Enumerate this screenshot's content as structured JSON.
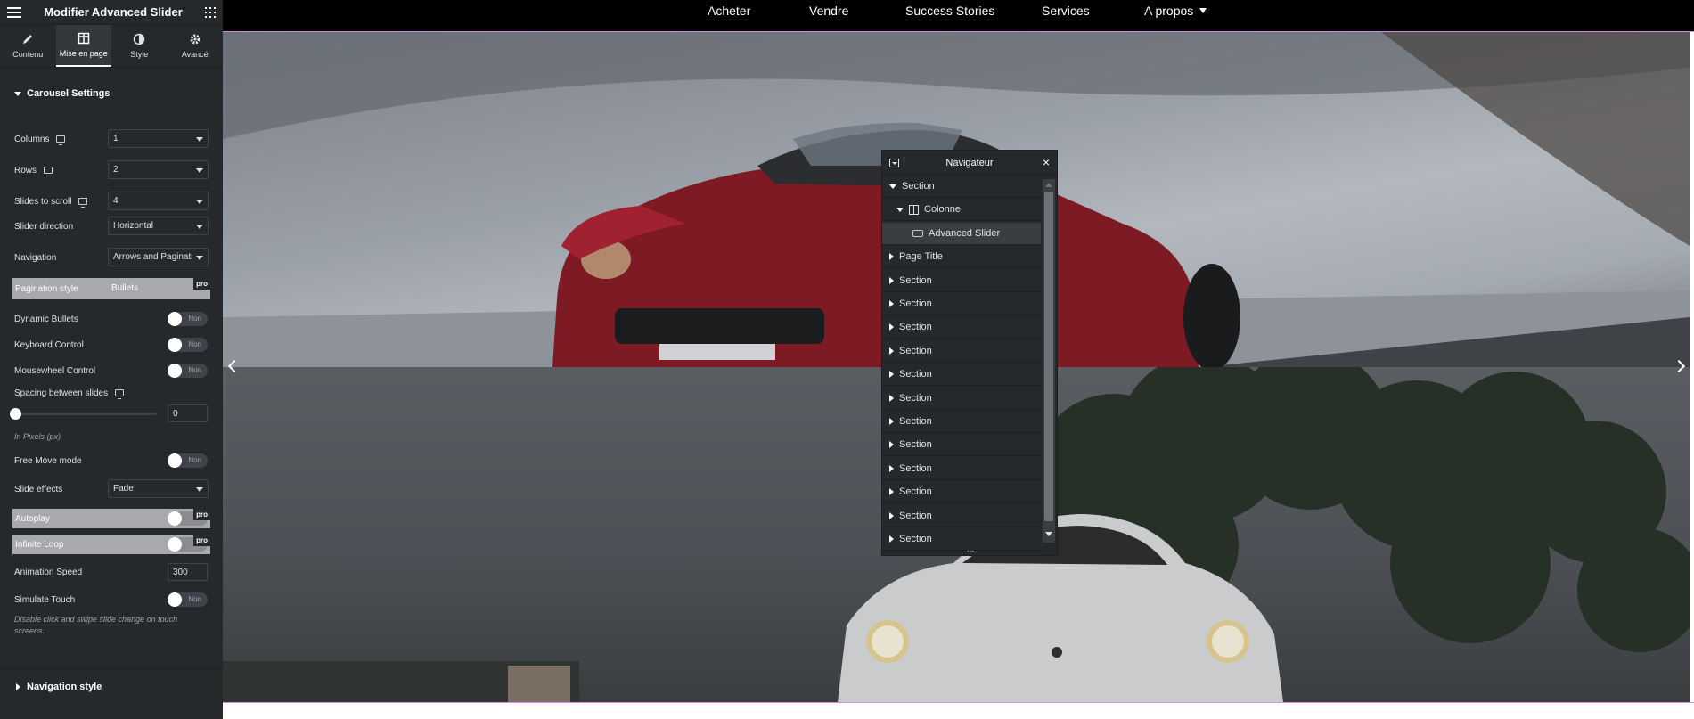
{
  "panel": {
    "title": "Modifier Advanced Slider",
    "tabs": [
      {
        "label": "Contenu",
        "icon": "pencil-icon"
      },
      {
        "label": "Mise en page",
        "icon": "layout-icon"
      },
      {
        "label": "Style",
        "icon": "contrast-icon"
      },
      {
        "label": "Avancé",
        "icon": "gear-icon"
      }
    ],
    "active_tab": "Mise en page",
    "section_title": "Carousel Settings",
    "columns": {
      "label": "Columns",
      "value": "1"
    },
    "rows": {
      "label": "Rows",
      "value": "2"
    },
    "slides_to_scroll": {
      "label": "Slides to scroll",
      "value": "4"
    },
    "slider_direction": {
      "label": "Slider direction",
      "value": "Horizontal"
    },
    "navigation": {
      "label": "Navigation",
      "value": "Arrows and Paginati"
    },
    "pagination_style": {
      "label": "Pagination style",
      "value": "Bullets",
      "badge": "pro"
    },
    "dynamic_bullets": {
      "label": "Dynamic Bullets",
      "state": "Non"
    },
    "keyboard_control": {
      "label": "Keyboard Control",
      "state": "Non"
    },
    "mousewheel_control": {
      "label": "Mousewheel Control",
      "state": "Non"
    },
    "spacing": {
      "label": "Spacing between slides",
      "value": "0",
      "note": "In Pixels (px)"
    },
    "free_move": {
      "label": "Free Move mode",
      "state": "Non"
    },
    "slide_effects": {
      "label": "Slide effects",
      "value": "Fade"
    },
    "autoplay": {
      "label": "Autoplay",
      "badge": "pro"
    },
    "infinite_loop": {
      "label": "Infinite Loop",
      "badge": "pro"
    },
    "animation_speed": {
      "label": "Animation Speed",
      "value": "300"
    },
    "simulate_touch": {
      "label": "Simulate Touch",
      "state": "Non",
      "note": "Disable click and swipe slide change on touch screens."
    },
    "navigation_style": "Navigation style"
  },
  "site_nav": {
    "items": [
      "Acheter",
      "Vendre",
      "Success Stories",
      "Services",
      "A propos"
    ]
  },
  "navigator": {
    "title": "Navigateur",
    "items": [
      {
        "label": "Section",
        "level": 0,
        "expanded": true
      },
      {
        "label": "Colonne",
        "level": 1,
        "expanded": true
      },
      {
        "label": "Advanced Slider",
        "level": 2,
        "selected": true
      },
      {
        "label": "Page Title",
        "level": 0
      },
      {
        "label": "Section",
        "level": 0
      },
      {
        "label": "Section",
        "level": 0
      },
      {
        "label": "Section",
        "level": 0
      },
      {
        "label": "Section",
        "level": 0
      },
      {
        "label": "Section",
        "level": 0
      },
      {
        "label": "Section",
        "level": 0
      },
      {
        "label": "Section",
        "level": 0
      },
      {
        "label": "Section",
        "level": 0
      },
      {
        "label": "Section",
        "level": 0
      },
      {
        "label": "Section",
        "level": 0
      },
      {
        "label": "Section",
        "level": 0
      },
      {
        "label": "Section",
        "level": 0
      }
    ],
    "footer": "..."
  },
  "colors": {
    "panel_bg": "#26292c",
    "accent": "#d28ee0",
    "car_red": "#9b1b2a"
  }
}
